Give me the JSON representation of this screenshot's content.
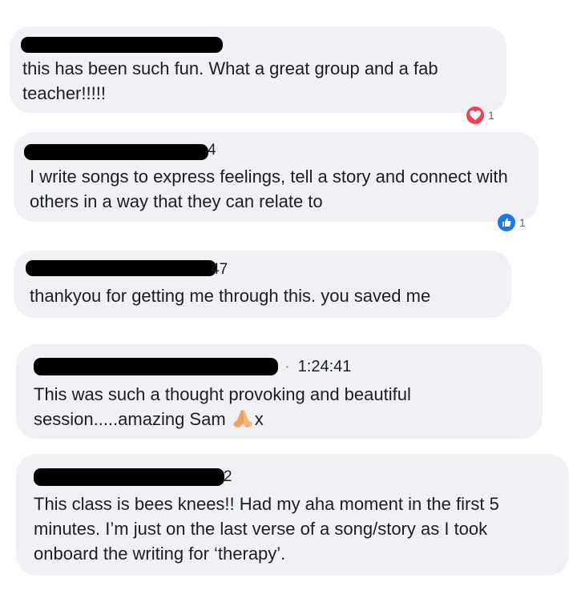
{
  "comments": [
    {
      "text": "this has been such fun. What a great group and a fab teacher!!!!!",
      "reactions": {
        "type": "heart",
        "count": "1",
        "color": "#f33e58"
      }
    },
    {
      "meta_tail": "4",
      "text": "I write songs to express feelings, tell a story and connect with others in a way that they can relate to",
      "reactions": {
        "type": "like",
        "count": "1",
        "color": "#1877f2"
      }
    },
    {
      "meta_tail": "47",
      "text": "thankyou for getting me through this. you saved me"
    },
    {
      "time": "1:24:41",
      "text_before_emoji": "This was such a thought provoking and beautiful session.....amazing Sam ",
      "emoji": "folded-hands",
      "text_after_emoji": "x"
    },
    {
      "meta_tail": "2",
      "text": "This class is bees knees!! Had my aha moment in the first 5 minutes. I’m just on the last verse of a song/story as I took onboard the writing for ‘therapy’."
    }
  ],
  "colors": {
    "bubble": "#eff1f4",
    "redaction": "#000000",
    "time_dot": "#e4606d"
  }
}
